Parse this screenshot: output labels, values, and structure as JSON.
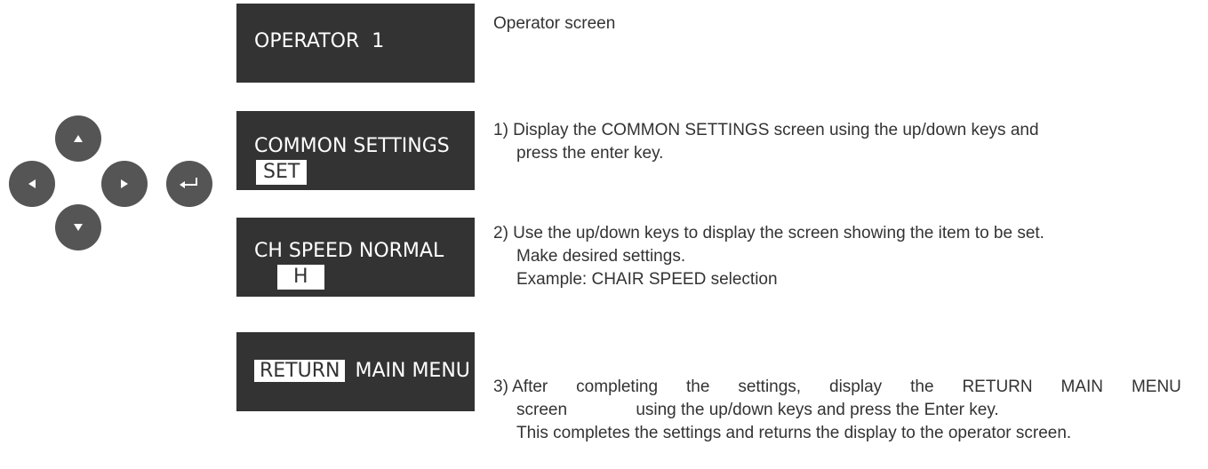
{
  "screens": [
    {
      "line1": "OPERATOR  1",
      "line2": ""
    },
    {
      "line1": "COMMON SETTINGS",
      "line2": "SET"
    },
    {
      "line1": "CH SPEED NORMAL",
      "line2": "H"
    },
    {
      "line1_hl": "RETURN",
      "line1_rest": "MAIN MENU"
    }
  ],
  "descriptions": {
    "operator": "Operator screen",
    "step1": [
      "1) Display the COMMON SETTINGS screen using the up/down keys and",
      "press the enter key."
    ],
    "step2": [
      "2) Use the up/down keys to display the screen showing the item to be set.",
      "Make desired settings.",
      "Example: CHAIR SPEED selection"
    ],
    "step3": {
      "line1_words": [
        "3) After",
        "completing",
        "the",
        "settings,",
        "display",
        "the",
        "RETURN",
        "MAIN",
        "MENU"
      ],
      "line2a": "screen",
      "line2b": "using the up/down keys and press the Enter key.",
      "line3": "This completes the settings and returns the display to the operator screen."
    }
  },
  "keypad": [
    "up-arrow-icon",
    "down-arrow-icon",
    "left-arrow-icon",
    "right-arrow-icon",
    "enter-icon"
  ]
}
